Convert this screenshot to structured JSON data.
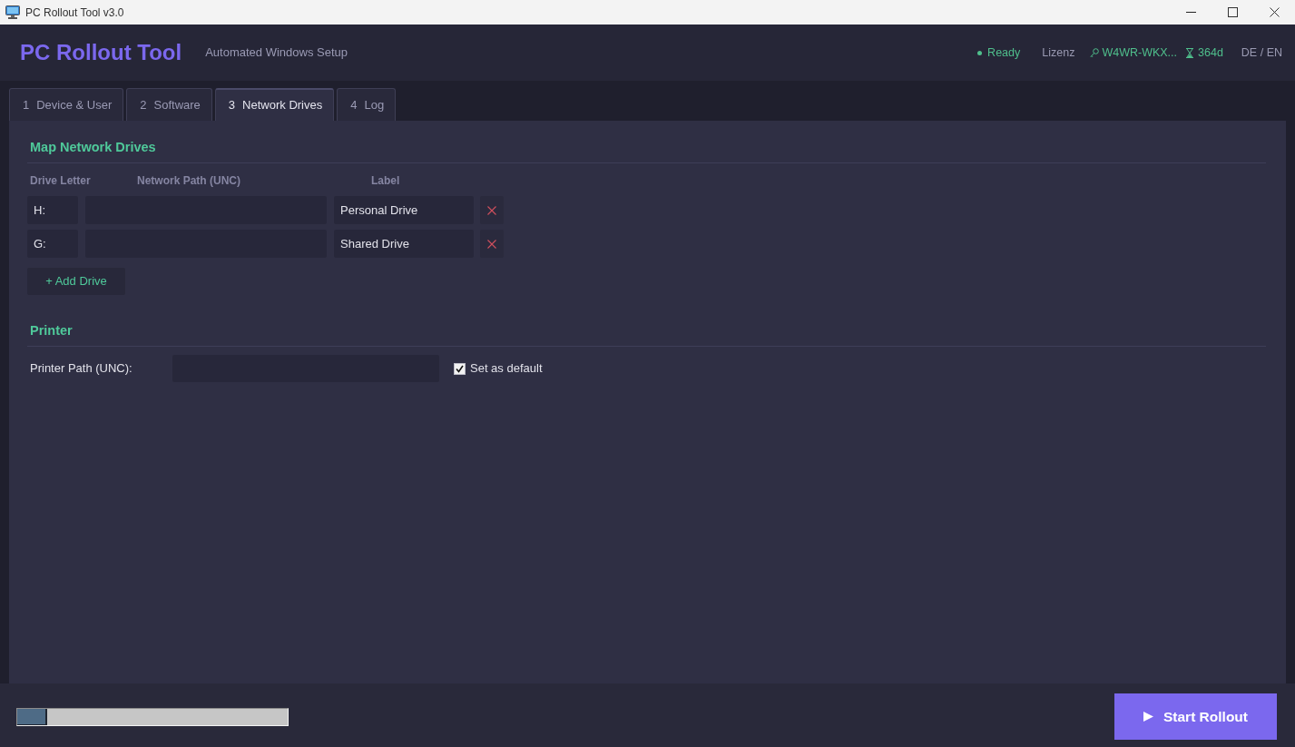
{
  "window": {
    "title": "PC Rollout Tool v3.0"
  },
  "header": {
    "title": "PC Rollout Tool",
    "subtitle": "Automated Windows Setup",
    "status": "Ready",
    "license_label": "Lizenz",
    "license_key": "W4WR-WKX...",
    "license_days": "364d",
    "language": "DE / EN"
  },
  "tabs": [
    {
      "number": "1",
      "label": "Device & User",
      "selected": false
    },
    {
      "number": "2",
      "label": "Software",
      "selected": false
    },
    {
      "number": "3",
      "label": "Network Drives",
      "selected": true
    },
    {
      "number": "4",
      "label": "Log",
      "selected": false
    }
  ],
  "drives_section": {
    "title": "Map Network Drives",
    "columns": [
      "Drive Letter",
      "Network Path (UNC)",
      "Label"
    ],
    "drives": [
      {
        "letter": "H:",
        "label": "Personal Drive"
      },
      {
        "letter": "G:",
        "label": "Shared Drive"
      }
    ],
    "add_button": "+ Add Drive"
  },
  "printer_section": {
    "title": "Printer",
    "path_label": "Printer Path (UNC):",
    "set_default": {
      "label": "Set as default",
      "checked": true
    }
  },
  "footer": {
    "progress": {
      "level": 0.11
    },
    "start_button": "Start Rollout"
  }
}
